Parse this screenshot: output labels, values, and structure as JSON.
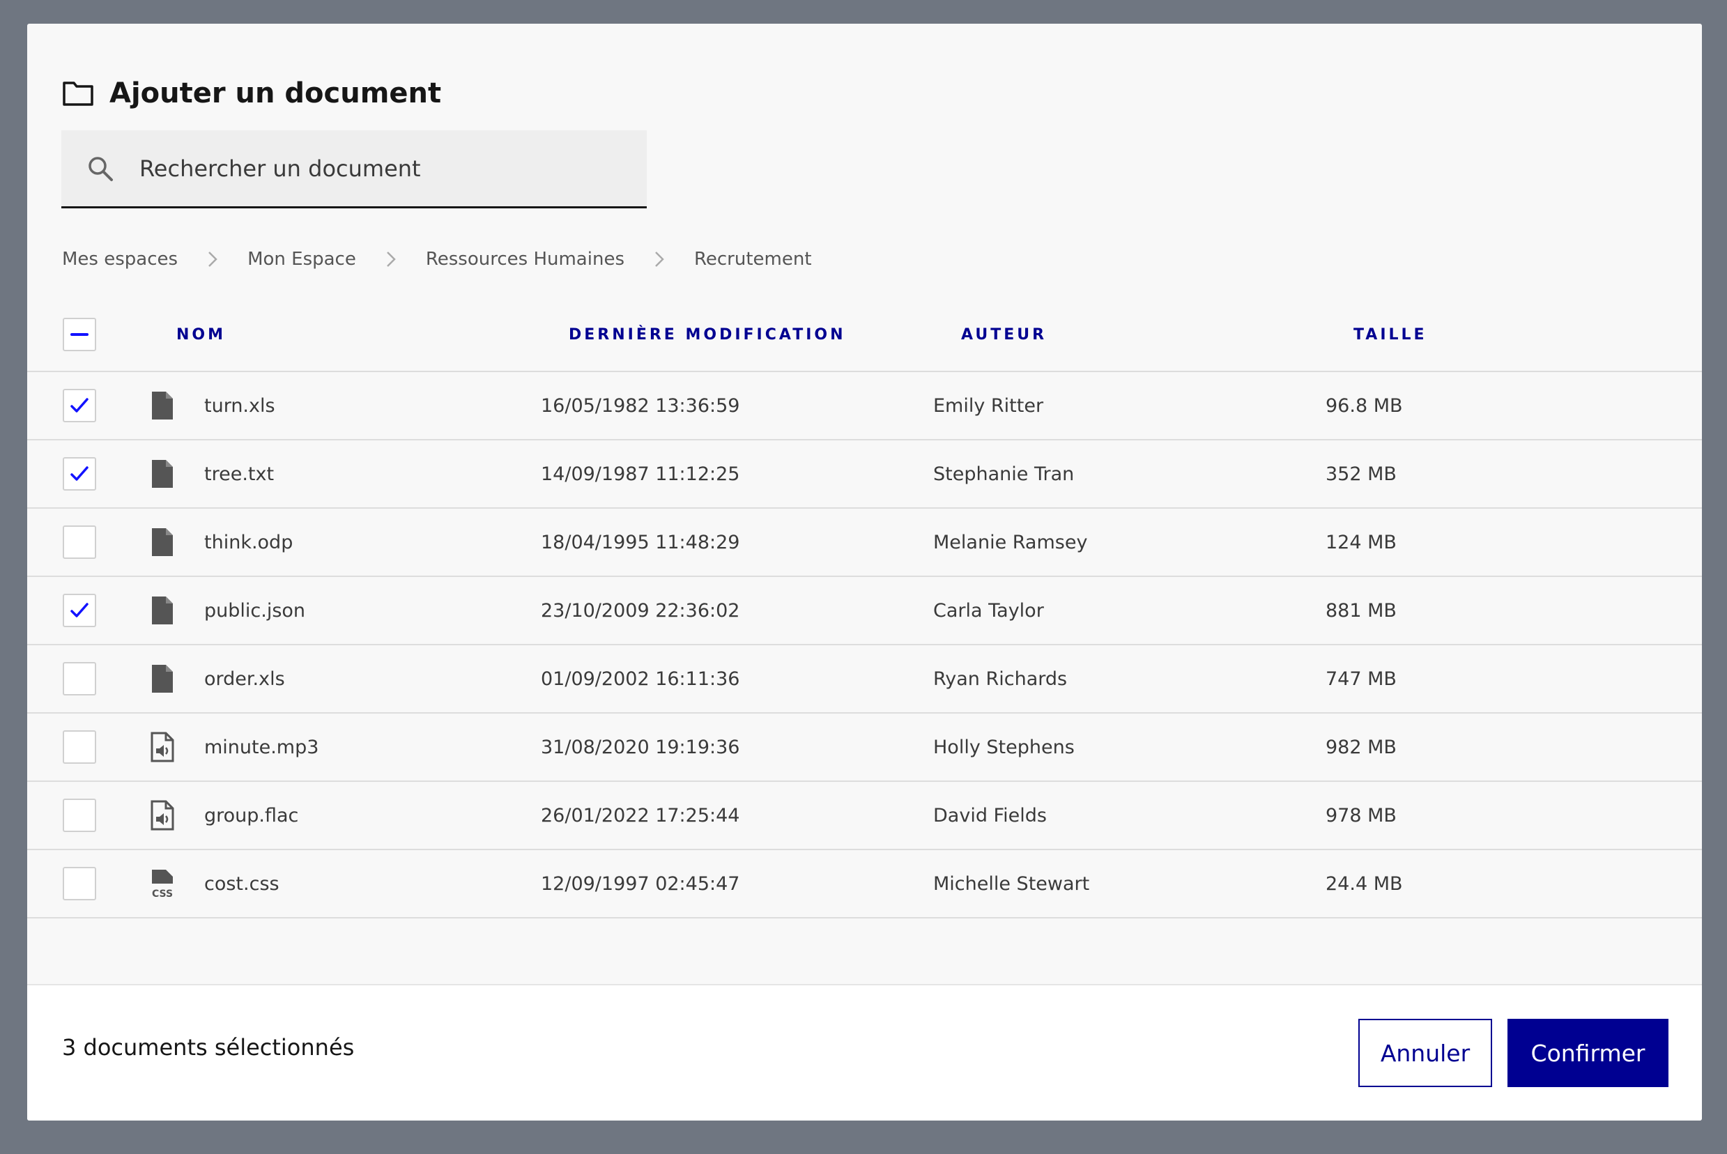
{
  "dialog": {
    "title": "Ajouter un document"
  },
  "search": {
    "placeholder": "Rechercher un document"
  },
  "breadcrumb": [
    "Mes espaces",
    "Mon Espace",
    "Ressources Humaines",
    "Recrutement"
  ],
  "table": {
    "headers": {
      "name": "NOM",
      "modified": "DERNIÈRE MODIFICATION",
      "author": "AUTEUR",
      "size": "TAILLE"
    },
    "select_all_state": "indeterminate",
    "rows": [
      {
        "name": "turn.xls",
        "modified": "16/05/1982 13:36:59",
        "author": "Emily Ritter",
        "size": "96.8 MB",
        "checked": true,
        "icon": "file-icon"
      },
      {
        "name": "tree.txt",
        "modified": "14/09/1987 11:12:25",
        "author": "Stephanie Tran",
        "size": "352 MB",
        "checked": true,
        "icon": "file-icon"
      },
      {
        "name": "think.odp",
        "modified": "18/04/1995 11:48:29",
        "author": "Melanie Ramsey",
        "size": "124 MB",
        "checked": false,
        "icon": "file-icon"
      },
      {
        "name": "public.json",
        "modified": "23/10/2009 22:36:02",
        "author": "Carla Taylor",
        "size": "881 MB",
        "checked": true,
        "icon": "file-icon"
      },
      {
        "name": "order.xls",
        "modified": "01/09/2002 16:11:36",
        "author": "Ryan Richards",
        "size": "747 MB",
        "checked": false,
        "icon": "file-icon"
      },
      {
        "name": "minute.mp3",
        "modified": "31/08/2020 19:19:36",
        "author": "Holly Stephens",
        "size": "982 MB",
        "checked": false,
        "icon": "audio-file-icon"
      },
      {
        "name": "group.flac",
        "modified": "26/01/2022 17:25:44",
        "author": "David Fields",
        "size": "978 MB",
        "checked": false,
        "icon": "audio-file-icon"
      },
      {
        "name": "cost.css",
        "modified": "12/09/1997 02:45:47",
        "author": "Michelle Stewart",
        "size": "24.4 MB",
        "checked": false,
        "icon": "css-file-icon"
      }
    ]
  },
  "footer": {
    "selected_count": "3 documents sélectionnés",
    "cancel_label": "Annuler",
    "confirm_label": "Confirmer"
  },
  "colors": {
    "accent": "#000091",
    "backdrop": "#6f7681",
    "checkmark": "#1212ff"
  }
}
